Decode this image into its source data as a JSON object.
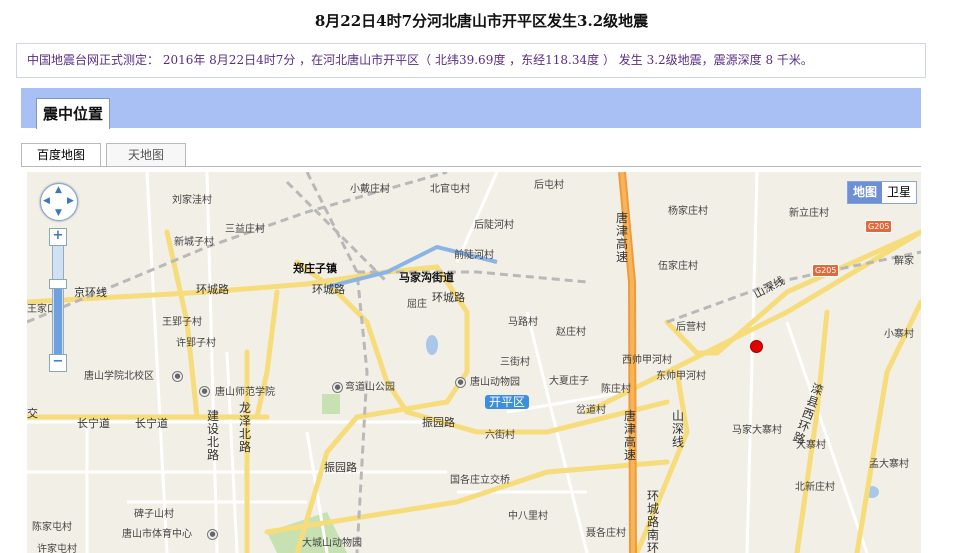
{
  "title": "8月22日4时7分河北唐山市开平区发生3.2级地震",
  "info": "中国地震台网正式测定： 2016年 8月22日4时7分 ，在河北唐山市开平区（ 北纬39.69度 ，东经118.34度 ） 发生 3.2级地震，震源深度 8 千米。",
  "section_tab": "震中位置",
  "tabs": [
    "百度地图",
    "天地图"
  ],
  "map_toggle": [
    "地图",
    "卫星"
  ],
  "labels": {
    "l1": "小戴庄村",
    "l2": "北官屯村",
    "l3": "后屯村",
    "l4": "刘家洼村",
    "l5": "三益庄村",
    "l6": "后陡河村",
    "l7": "杨家庄村",
    "l8": "新立庄村",
    "l9": "新城子村",
    "l10": "前陡河村",
    "l11": "郑庄子镇",
    "l12": "马家沟街道",
    "l13": "伍家庄村",
    "l14": "解家",
    "l15": "京环线",
    "l16": "环城路",
    "l17": "环城路",
    "l18": "环城路",
    "l19": "屈庄",
    "l20": "王家口",
    "l21": "王郢子村",
    "l22": "马路村",
    "l23": "赵庄村",
    "l24": "后营村",
    "l25": "许郢子村",
    "l26": "三街村",
    "l27": "西帅甲河村",
    "l28": "小寨村",
    "l29": "唐山学院北校区",
    "l30": "唐山师范学院",
    "l31": "弯道山公园",
    "l32": "唐山动物园",
    "l33": "大夏庄子",
    "l34": "陈庄村",
    "l35": "东帅甲河村",
    "l36": "交",
    "l37": "长宁道",
    "l38": "长宁道",
    "l39": "振园路",
    "l40": "开平区",
    "l41": "岔道村",
    "l42": "马家大寨村",
    "l43": "大寨村",
    "l44": "六街村",
    "l45": "孟大寨村",
    "l46": "国各庄立交桥",
    "l47": "振园路",
    "l48": "北新庄村",
    "l49": "陈家屯村",
    "l50": "碑子山村",
    "l51": "中八里村",
    "l52": "聂各庄村",
    "l53": "唐山市体育中心",
    "l54": "大城山动物园",
    "l55": "许家屯村",
    "l56": "山深线",
    "l57": "山深线",
    "l58": "龙泽北路",
    "l59": "建设北路",
    "l60": "唐津高速",
    "l61": "唐津高速",
    "l62": "环城路南环",
    "l63": "滦县西环路"
  },
  "shields": {
    "s1": "G205",
    "s2": "G205"
  },
  "colors": {
    "accent": "#a9c0f4",
    "epicenter": "#e40000",
    "info_text": "#5a2c86"
  }
}
